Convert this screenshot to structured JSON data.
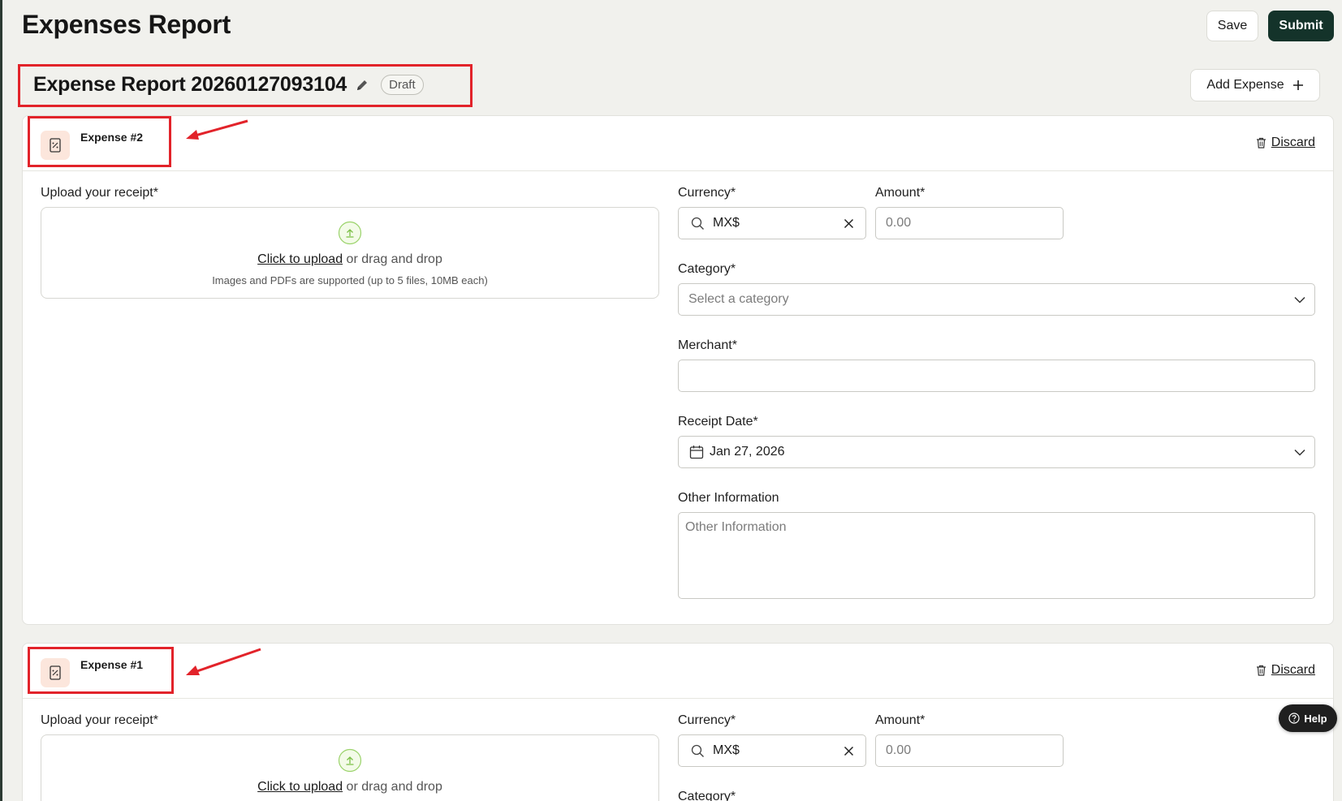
{
  "header": {
    "title": "Expenses Report",
    "save_label": "Save",
    "submit_label": "Submit"
  },
  "report": {
    "title": "Expense Report 20260127093104",
    "status": "Draft",
    "add_expense_label": "Add Expense"
  },
  "expenses": [
    {
      "title": "Expense #2",
      "discard_label": "Discard",
      "receipt_label": "Upload your receipt*",
      "upload_link": "Click to upload",
      "upload_text": " or drag and drop",
      "upload_hint": "Images and PDFs are supported (up to 5 files, 10MB each)",
      "currency_label": "Currency*",
      "currency_value": "MX$",
      "amount_label": "Amount*",
      "amount_placeholder": "0.00",
      "category_label": "Category*",
      "category_placeholder": "Select a category",
      "merchant_label": "Merchant*",
      "merchant_value": "",
      "receipt_date_label": "Receipt Date*",
      "receipt_date_value": "Jan 27, 2026",
      "other_info_label": "Other Information",
      "other_info_placeholder": "Other Information"
    },
    {
      "title": "Expense #1",
      "discard_label": "Discard",
      "receipt_label": "Upload your receipt*",
      "upload_link": "Click to upload",
      "upload_text": " or drag and drop",
      "currency_label": "Currency*",
      "currency_value": "MX$",
      "amount_label": "Amount*",
      "amount_placeholder": "0.00",
      "category_label": "Category*"
    }
  ],
  "help": {
    "label": "Help"
  },
  "colors": {
    "background": "#f1f1ed",
    "primary": "#14332a",
    "annotation": "#e2232a",
    "icon_bg": "#fce6dc"
  }
}
